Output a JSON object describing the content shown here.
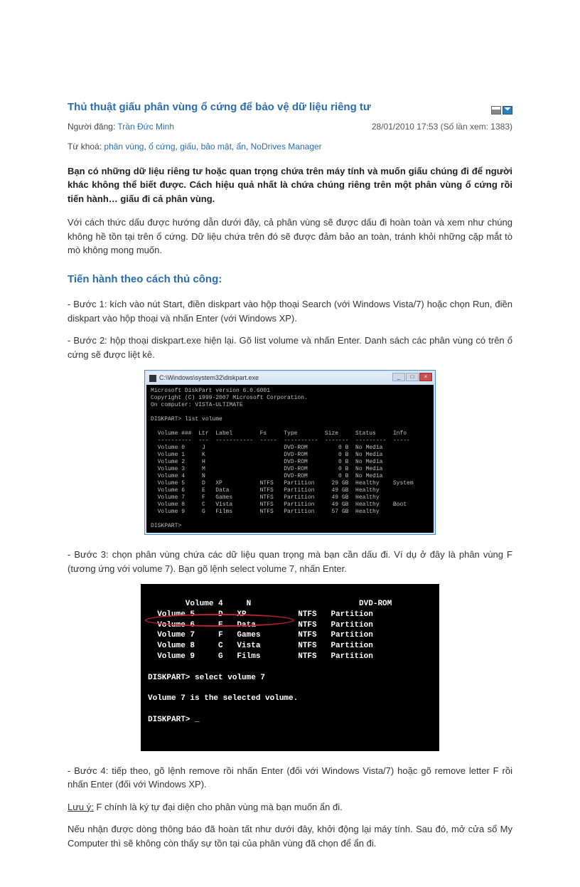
{
  "header": {
    "title": "Thủ thuật giấu phân vùng ổ cứng để bảo vệ dữ liệu riêng tư",
    "author_label": "Người đăng:",
    "author_name": "Trần Đức Minh",
    "date_views": "28/01/2010 17:53 (Số lần xem: 1383)",
    "tags_label": "Từ khoá:",
    "tags": [
      "phân vùng",
      "ổ cứng",
      "giấu",
      "bảo mật",
      "ẩn",
      "NoDrives Manager"
    ]
  },
  "intro": "Bạn có những dữ liệu riêng tư hoặc quan trọng chứa trên máy tính và muốn giấu chúng đi để người khác không thể biết được. Cách hiệu quả nhất là chứa chúng riêng trên một phân vùng ổ cứng rồi tiến hành… giấu đi cả phân vùng.",
  "para1": "Với cách thức dấu được hướng dẫn dưới đây, cả phân vùng sẽ được dấu đi hoàn toàn và xem như chúng không hề tồn tại trên ổ cứng. Dữ liệu chứa trên đó sẽ được đảm bảo an toàn, tránh khỏi những cặp mắt tò mò không mong muốn.",
  "section1_title": "Tiến hành theo cách thủ công:",
  "step1": "- Bước 1: kích vào nút Start, điền diskpart vào hộp thoại Search (với Windows Vista/7) hoặc chọn Run, điền diskpart vào hộp thoại và nhấn Enter (với Windows XP).",
  "step2": "- Bước 2: hộp thoại diskpart.exe hiện lại. Gõ list volume và nhấn Enter. Danh sách các phân vùng có trên ổ cứng sẽ được liệt kê.",
  "terminal1": {
    "title": "C:\\Windows\\system32\\diskpart.exe",
    "content": "Microsoft DiskPart version 6.0.6001\nCopyright (C) 1999-2007 Microsoft Corporation.\nOn computer: VISTA-ULTIMATE\n\nDISKPART> list volume\n\n  Volume ###  Ltr  Label        Fs     Type        Size     Status     Info\n  ----------  ---  -----------  -----  ----------  -------  ---------  -----\n  Volume 0     J                       DVD-ROM         0 B  No Media\n  Volume 1     K                       DVD-ROM         0 B  No Media\n  Volume 2     H                       DVD-ROM         0 B  No Media\n  Volume 3     M                       DVD-ROM         0 B  No Media\n  Volume 4     N                       DVD-ROM         0 B  No Media\n  Volume 5     D   XP           NTFS   Partition     29 GB  Healthy    System\n  Volume 6     E   Data         NTFS   Partition     49 GB  Healthy\n  Volume 7     F   Games        NTFS   Partition     49 GB  Healthy\n  Volume 8     C   Vista        NTFS   Partition     49 GB  Healthy    Boot\n  Volume 9     G   Films        NTFS   Partition     57 GB  Healthy\n\nDISKPART>"
  },
  "step3": "- Bước 3: chọn phân vùng chứa các dữ liệu quan trọng mà bạn cần dấu đi. Ví dụ ở đây là phân vùng F (tương ứng với volume 7). Bạn gõ lệnh select volume 7, nhấn Enter.",
  "terminal2": {
    "content": "  Volume 4     N                       DVD-ROM\n  Volume 5     D   XP           NTFS   Partition\n  Volume 6     E   Data         NTFS   Partition\n  Volume 7     F   Games        NTFS   Partition\n  Volume 8     C   Vista        NTFS   Partition\n  Volume 9     G   Films        NTFS   Partition\n\nDISKPART> select volume 7\n\nVolume 7 is the selected volume.\n\nDISKPART> _"
  },
  "step4": "- Bước 4: tiếp theo, gõ lệnh remove rồi nhấn Enter (đối với Windows Vista/7) hoặc gõ remove letter F rồi nhấn Enter (đối với Windows XP).",
  "note_label": "Lưu ý:",
  "note_text": " F chính là ký tự đại diện cho phân vùng mà bạn muốn ẩn đi.",
  "para_last": "Nếu nhận được dòng thông báo đã hoàn tất như dưới đây, khởi động lại máy tính. Sau đó, mở cửa sổ My Computer thì sẽ không còn thấy sự tồn tại của phân vùng đã chọn để ẩn đi."
}
